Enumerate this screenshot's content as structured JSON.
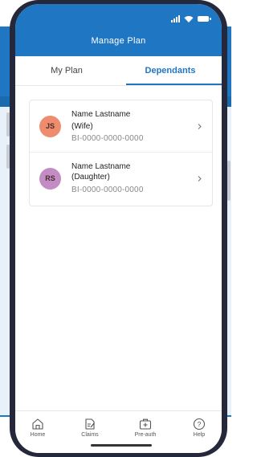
{
  "app_bar": {
    "title": "Manage Plan"
  },
  "tabs": [
    {
      "label": "My Plan",
      "active": false
    },
    {
      "label": "Dependants",
      "active": true
    }
  ],
  "dependants": [
    {
      "initials": "JS",
      "name": "Name Lastname",
      "relation": "(Wife)",
      "policy": "BI-0000-0000-0000",
      "avatar_color": "#f08c6e"
    },
    {
      "initials": "RS",
      "name": "Name Lastname",
      "relation": "(Daughter)",
      "policy": "BI-0000-0000-0000",
      "avatar_color": "#c48cc4"
    }
  ],
  "bottom_nav": [
    {
      "label": "Home",
      "icon": "home-icon"
    },
    {
      "label": "Claims",
      "icon": "claims-icon"
    },
    {
      "label": "Pre-auth",
      "icon": "pre-auth-icon"
    },
    {
      "label": "Help",
      "icon": "help-icon"
    }
  ],
  "colors": {
    "primary": "#1f77c4",
    "backdrop": "#e8f1fa",
    "phone_frame": "#24283a"
  }
}
